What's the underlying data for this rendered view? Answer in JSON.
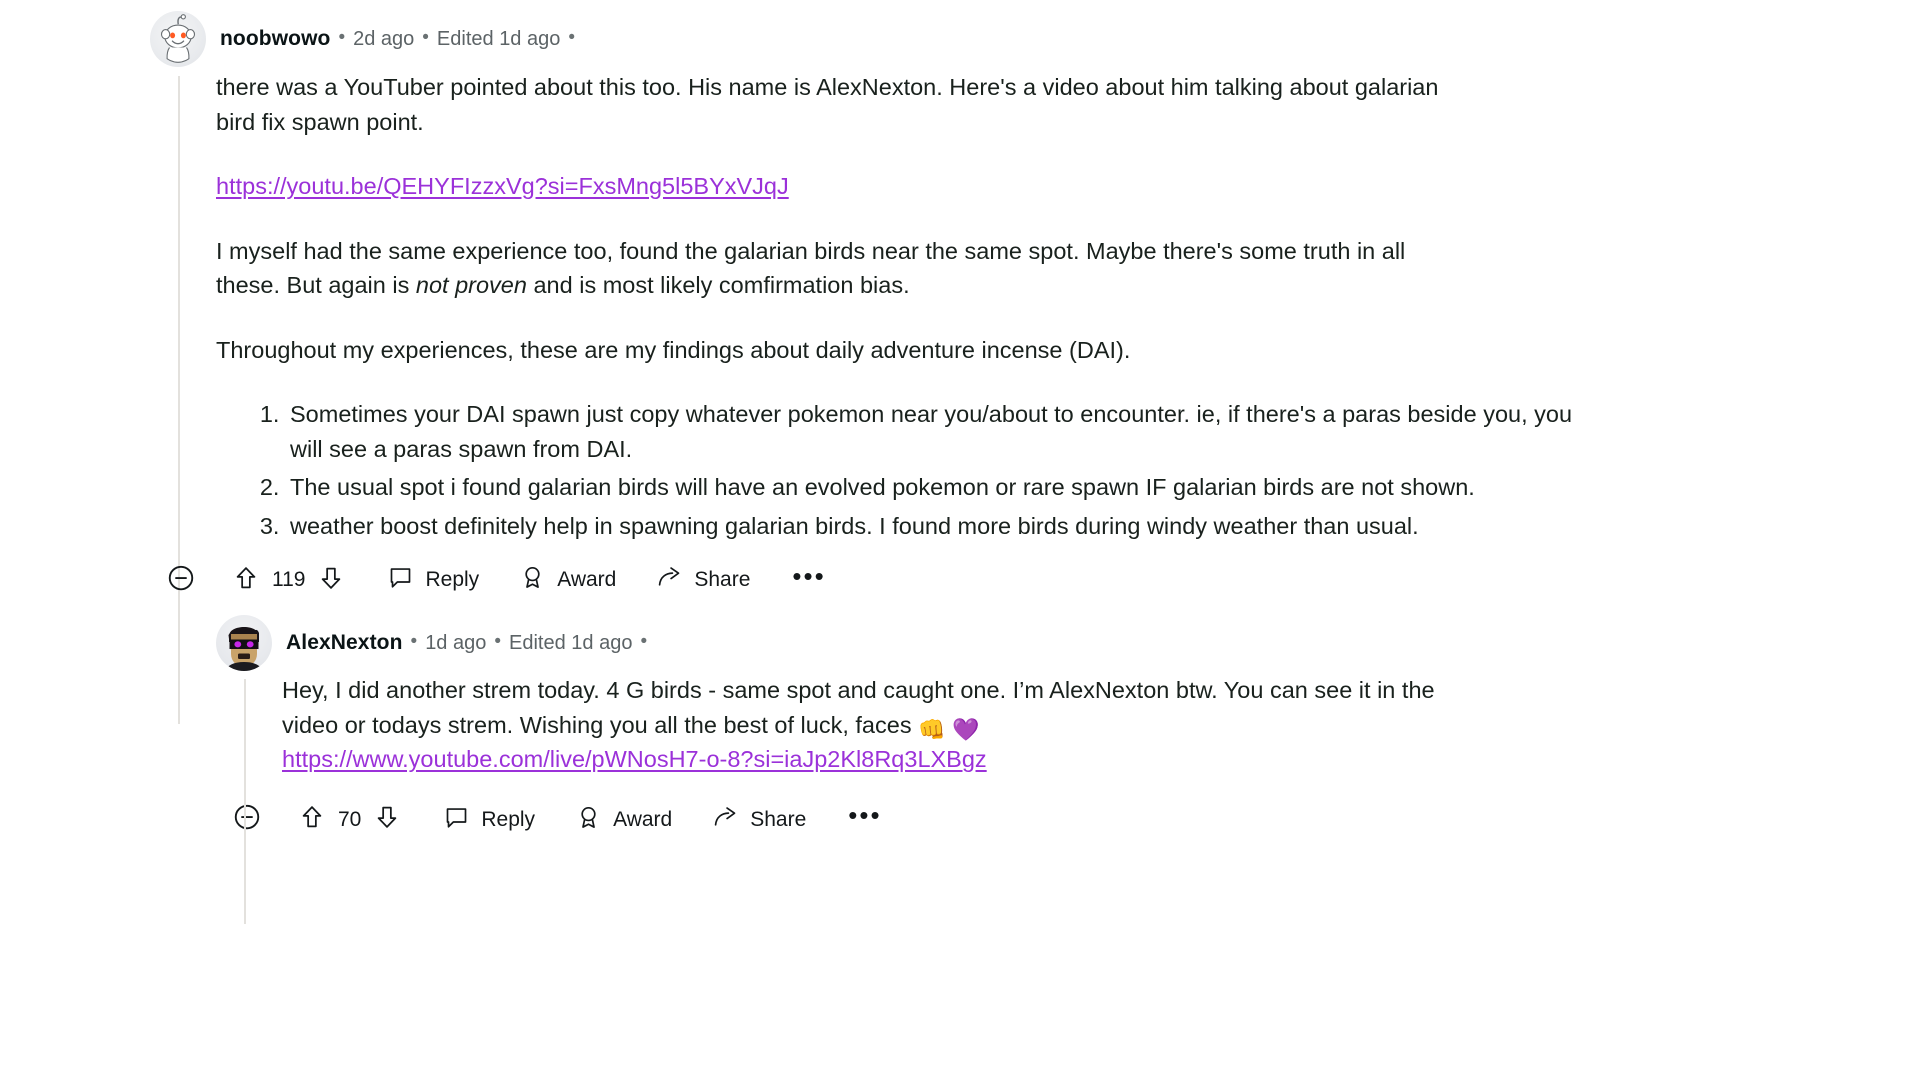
{
  "colors": {
    "link": "#9b31d9",
    "text": "#19211d",
    "meta": "#5c6366",
    "thread_line": "#e3e1dd",
    "background": "#ffffff"
  },
  "comment": {
    "author": "noobwowo",
    "avatar": "snoo-avatar",
    "posted": "2d ago",
    "edited": "Edited 1d ago",
    "separator": "•",
    "paragraphs": {
      "p1": "there was a YouTuber pointed about this too. His name is AlexNexton. Here's a video about him talking about galarian bird fix spawn point.",
      "link1": "https://youtu.be/QEHYFIzzxVg?si=FxsMng5l5BYxVJqJ",
      "p2_a": "I myself had the same experience too, found the galarian birds near the same spot. Maybe there's some truth in all these. But again is ",
      "p2_em": "not proven",
      "p2_b": " and is most likely comfirmation bias.",
      "p3": "Throughout my experiences, these are my findings about daily adventure incense (DAI)."
    },
    "list": [
      "Sometimes your DAI spawn just copy whatever pokemon near you/about to encounter. ie, if there's a paras beside you, you will see a paras spawn from DAI.",
      "The usual spot i found galarian birds will have an evolved pokemon or rare spawn IF galarian birds are not shown.",
      "weather boost definitely help in spawning galarian birds. I found more birds during windy weather than usual."
    ],
    "actions": {
      "collapse": "collapse-icon",
      "upvote": "upvote-icon",
      "score": "119",
      "downvote": "downvote-icon",
      "reply": "Reply",
      "award": "Award",
      "share": "Share",
      "more": "•••"
    }
  },
  "reply": {
    "author": "AlexNexton",
    "avatar": "alexnexton-avatar",
    "posted": "1d ago",
    "edited": "Edited 1d ago",
    "separator": "•",
    "body_a": "Hey, I did another strem today. 4 G birds - same spot and caught one. I’m AlexNexton btw. You can see it in the video or todays strem. Wishing you all the best of luck, faces ",
    "emoji1": "👊",
    "emoji2": "💜",
    "link": "https://www.youtube.com/live/pWNosH7-o-8?si=iaJp2Kl8Rq3LXBgz",
    "actions": {
      "collapse": "collapse-icon",
      "upvote": "upvote-icon",
      "score": "70",
      "downvote": "downvote-icon",
      "reply": "Reply",
      "award": "Award",
      "share": "Share",
      "more": "•••"
    }
  }
}
